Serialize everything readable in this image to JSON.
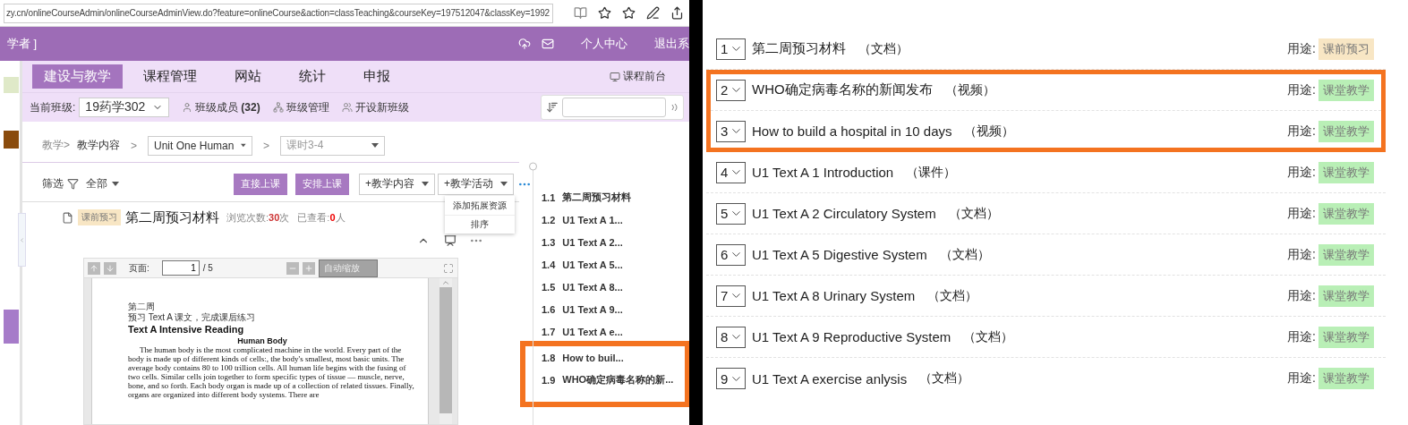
{
  "browser": {
    "url": "zy.cn/onlineCourseAdmin/onlineCourseAdminView.do?feature=onlineCourse&action=classTeaching&courseKey=197512047&classKey=1992"
  },
  "header": {
    "title": "学者 ]",
    "links": [
      "个人中心",
      "退出系"
    ]
  },
  "nav": {
    "tabs": [
      {
        "label": "建设与教学",
        "selected": true
      },
      {
        "label": "课程管理",
        "selected": false
      },
      {
        "label": "网站",
        "selected": false
      },
      {
        "label": "统计",
        "selected": false
      },
      {
        "label": "申报",
        "selected": false
      }
    ],
    "front_link": "课程前台"
  },
  "class_bar": {
    "label": "当前班级:",
    "class_select": "19药学302",
    "members": "班级成员",
    "member_count": "(32)",
    "manage": "班级管理",
    "new_class": "开设新班级"
  },
  "breadcrumb": {
    "root": "教学>",
    "current": "教学内容",
    "separator_1": ">",
    "unit_select": "Unit One Human",
    "separator_2": ">",
    "lesson_select": "课时3-4"
  },
  "toolbar": {
    "filter_label": "筛选",
    "filter_select": "全部",
    "buttons": [
      "直接上课",
      "安排上课"
    ],
    "dropdowns": [
      "+教学内容",
      "+教学活动"
    ]
  },
  "dropdown_menu": [
    "添加拓展资源",
    "排序"
  ],
  "item": {
    "badge": "课前预习",
    "title": "第二周预习材料",
    "views_label": "浏览次数:",
    "views": "30",
    "views_unit": "次",
    "viewed_label": "已查看:",
    "viewed": "0",
    "viewed_unit": "人"
  },
  "pdf_viewer": {
    "page_label": "页面:",
    "page": "1",
    "page_total": "/ 5",
    "zoom": "自动缩放",
    "document": {
      "week": "第二周",
      "instruction": "预习 Text A 课文，完成课后练习",
      "heading": "Text A Intensive Reading",
      "subheading": "Human Body",
      "paragraph": "The human body is the most complicated machine in the world. Every part of the body is made up of different kinds of cells:, the body's smallest, most basic units. The average body contains 80 to 100 trillion cells. All human life begins with the fusing of two cells. Similar cells join together to form specific types of tissue — muscle, nerve, bone, and so forth. Each body organ is made up of a collection of related tissues. Finally, organs are organized into different body systems. There are"
    }
  },
  "outline": [
    {
      "number": "1.1",
      "title": "第二周预习材料",
      "highlighted": false
    },
    {
      "number": "1.2",
      "title": "U1 Text A 1...",
      "highlighted": false
    },
    {
      "number": "1.3",
      "title": "U1 Text A 2...",
      "highlighted": false
    },
    {
      "number": "1.4",
      "title": "U1 Text A 5...",
      "highlighted": false
    },
    {
      "number": "1.5",
      "title": "U1 Text A 8...",
      "highlighted": false
    },
    {
      "number": "1.6",
      "title": "U1 Text A 9...",
      "highlighted": false
    },
    {
      "number": "1.7",
      "title": "U1 Text A e...",
      "highlighted": false
    },
    {
      "number": "1.8",
      "title": "How to buil...",
      "highlighted": true
    },
    {
      "number": "1.9",
      "title": "WHO确定病毒名称的新...",
      "highlighted": true
    }
  ],
  "resources": [
    {
      "number": "1",
      "title": "第二周预习材料",
      "type": "（文档）",
      "usage_label": "用途:",
      "usage": "课前预习",
      "color": "#f8e6c4",
      "highlighted": false
    },
    {
      "number": "2",
      "title": "WHO确定病毒名称的新闻发布",
      "type": "（视频）",
      "usage_label": "用途:",
      "usage": "课堂教学",
      "color": "#b9efb6",
      "highlighted": true
    },
    {
      "number": "3",
      "title": "How to build a hospital in 10 days",
      "type": "（视频）",
      "usage_label": "用途:",
      "usage": "课堂教学",
      "color": "#b9efb6",
      "highlighted": true
    },
    {
      "number": "4",
      "title": "U1 Text A 1 Introduction",
      "type": "（课件）",
      "usage_label": "用途:",
      "usage": "课堂教学",
      "color": "#b9efb6",
      "highlighted": false
    },
    {
      "number": "5",
      "title": "U1 Text A 2 Circulatory System",
      "type": "（文档）",
      "usage_label": "用途:",
      "usage": "课堂教学",
      "color": "#b9efb6",
      "highlighted": false
    },
    {
      "number": "6",
      "title": "U1 Text A 5 Digestive System",
      "type": "（文档）",
      "usage_label": "用途:",
      "usage": "课堂教学",
      "color": "#b9efb6",
      "highlighted": false
    },
    {
      "number": "7",
      "title": "U1 Text A 8 Urinary System",
      "type": "（文档）",
      "usage_label": "用途:",
      "usage": "课堂教学",
      "color": "#b9efb6",
      "highlighted": false
    },
    {
      "number": "8",
      "title": "U1 Text A 9 Reproductive System",
      "type": "（文档）",
      "usage_label": "用途:",
      "usage": "课堂教学",
      "color": "#b9efb6",
      "highlighted": false
    },
    {
      "number": "9",
      "title": "U1 Text A exercise anlysis",
      "type": "（文档）",
      "usage_label": "用途:",
      "usage": "课堂教学",
      "color": "#b9efb6",
      "highlighted": false
    }
  ]
}
